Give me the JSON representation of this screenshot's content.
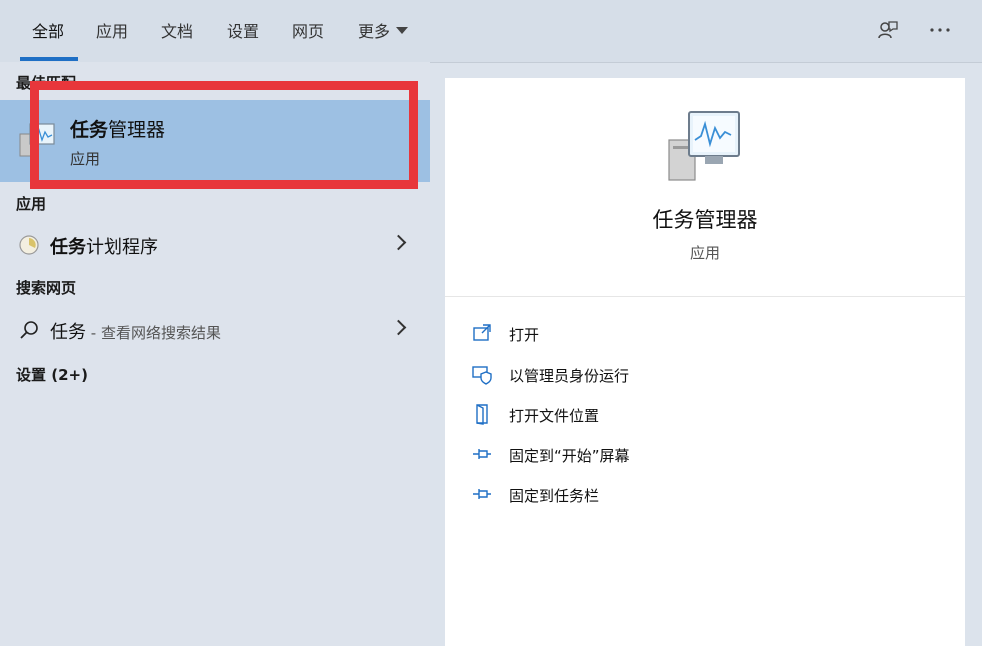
{
  "tabs": [
    {
      "label": "全部"
    },
    {
      "label": "应用"
    },
    {
      "label": "文档"
    },
    {
      "label": "设置"
    },
    {
      "label": "网页"
    },
    {
      "label": "更多"
    }
  ],
  "left": {
    "best_match_heading": "最佳匹配",
    "best_match": {
      "title_bold": "任务",
      "title_rest": "管理器",
      "subtitle": "应用"
    },
    "apps_heading": "应用",
    "app_item": {
      "title_bold": "任务",
      "title_rest": "计划程序"
    },
    "web_heading": "搜索网页",
    "web_item": {
      "title": "任务",
      "suffix": " - 查看网络搜索结果"
    },
    "settings_heading": "设置 (2+)"
  },
  "right": {
    "title": "任务管理器",
    "subtitle": "应用",
    "actions": [
      {
        "label": "打开",
        "icon": "open-icon"
      },
      {
        "label": "以管理员身份运行",
        "icon": "shield-icon"
      },
      {
        "label": "打开文件位置",
        "icon": "file-location-icon"
      },
      {
        "label": "固定到“开始”屏幕",
        "icon": "pin-icon"
      },
      {
        "label": "固定到任务栏",
        "icon": "pin-icon"
      }
    ]
  },
  "colors": {
    "accent": "#1f6fc5",
    "highlight": "#9dc0e3",
    "annotation": "#e8363b"
  }
}
